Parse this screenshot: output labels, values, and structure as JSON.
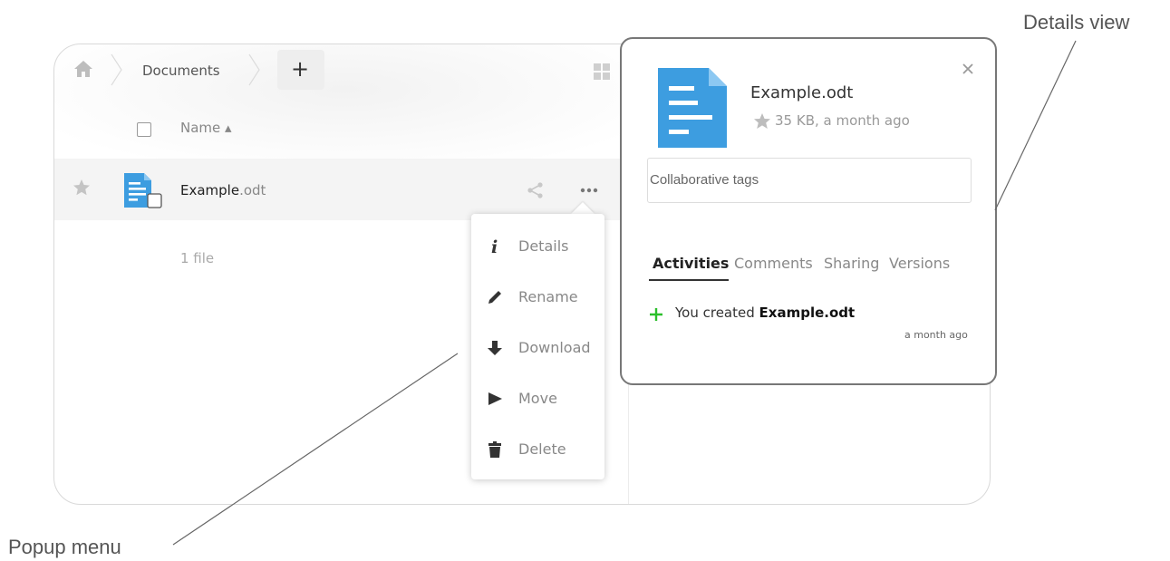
{
  "breadcrumb": {
    "folder": "Documents",
    "add_label": "+"
  },
  "file_list": {
    "header": {
      "name_label": "Name ▴"
    },
    "files": [
      {
        "name_base": "Example",
        "name_ext": ".odt"
      }
    ],
    "summary": "1 file"
  },
  "popup_menu": {
    "items": [
      {
        "label": "Details",
        "icon": "info-icon"
      },
      {
        "label": "Rename",
        "icon": "pencil-icon"
      },
      {
        "label": "Download",
        "icon": "download-icon"
      },
      {
        "label": "Move",
        "icon": "move-icon"
      },
      {
        "label": "Delete",
        "icon": "trash-icon"
      }
    ]
  },
  "details": {
    "filename": "Example.odt",
    "meta": "35 KB, a month ago",
    "tags_placeholder": "Collaborative tags",
    "tabs": [
      {
        "label": "Activities",
        "active": true
      },
      {
        "label": "Comments"
      },
      {
        "label": "Sharing"
      },
      {
        "label": "Versions"
      }
    ],
    "activity": {
      "prefix": "You created ",
      "file": "Example.odt",
      "time": "a month ago"
    }
  },
  "annotations": {
    "details_view": "Details view",
    "popup_menu": "Popup menu"
  },
  "colors": {
    "file_blue": "#3d9de0",
    "activity_green": "#2bbf2b",
    "accent_text": "#222222"
  }
}
